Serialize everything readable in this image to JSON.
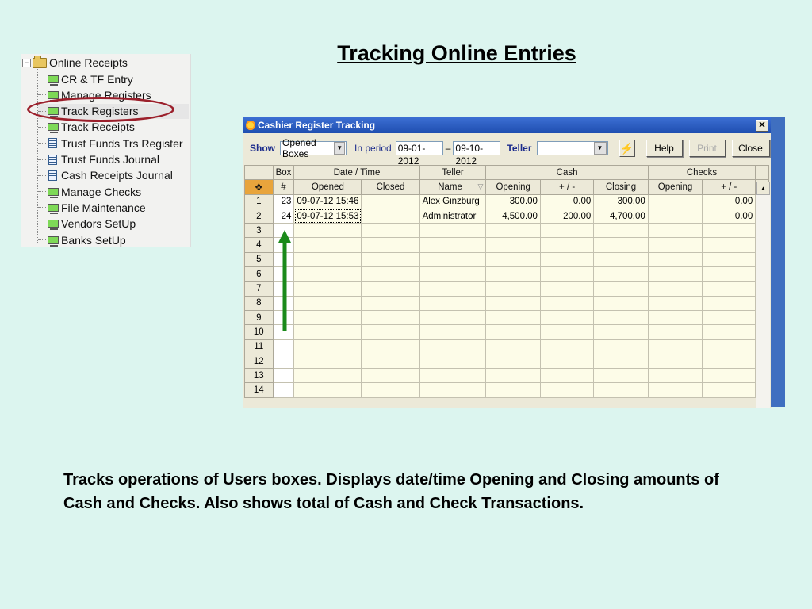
{
  "slide": {
    "title": "Tracking Online Entries",
    "description": "Tracks operations of Users boxes.  Displays date/time Opening and Closing amounts of Cash and Checks.  Also shows total of Cash and Check Transactions."
  },
  "tree": {
    "root": "Online Receipts",
    "items": [
      {
        "label": "CR & TF Entry",
        "icon": "computer-icon"
      },
      {
        "label": "Manage Registers",
        "icon": "computer-icon"
      },
      {
        "label": "Track Registers",
        "icon": "computer-icon"
      },
      {
        "label": "Track Receipts",
        "icon": "computer-icon"
      },
      {
        "label": "Trust Funds Trs Register",
        "icon": "document-icon"
      },
      {
        "label": "Trust Funds Journal",
        "icon": "document-icon"
      },
      {
        "label": "Cash Receipts Journal",
        "icon": "document-icon"
      },
      {
        "label": "Manage Checks",
        "icon": "computer-icon"
      },
      {
        "label": "File Maintenance",
        "icon": "computer-icon"
      },
      {
        "label": "Vendors SetUp",
        "icon": "computer-icon"
      },
      {
        "label": "Banks SetUp",
        "icon": "computer-icon"
      }
    ]
  },
  "window": {
    "title": "Cashier Register Tracking",
    "close": "✕",
    "toolbar": {
      "show_label": "Show",
      "show_value": "Opened Boxes",
      "period_label": "In period",
      "date_from": "09-01-2012",
      "date_sep": "–",
      "date_to": "09-10-2012",
      "teller_label": "Teller",
      "teller_value": "",
      "help": "Help",
      "print": "Print",
      "close": "Close"
    },
    "grid": {
      "groups": [
        "Box",
        "Date / Time",
        "Teller",
        "Cash",
        "Checks"
      ],
      "headers": [
        "#",
        "Opened",
        "Closed",
        "Name",
        "Opening",
        "+ / -",
        "Closing",
        "Opening",
        "+ / -"
      ],
      "rows": [
        {
          "n": "1",
          "box": "23",
          "opened": "09-07-12 15:46",
          "closed": "",
          "name": "Alex Ginzburg",
          "cash_open": "300.00",
          "cash_pm": "0.00",
          "cash_close": "300.00",
          "chk_open": "",
          "chk_pm": "0.00"
        },
        {
          "n": "2",
          "box": "24",
          "opened": "09-07-12 15:53",
          "closed": "",
          "name": "Administrator",
          "cash_open": "4,500.00",
          "cash_pm": "200.00",
          "cash_close": "4,700.00",
          "chk_open": "",
          "chk_pm": "0.00"
        }
      ],
      "empty_rows": [
        "3",
        "4",
        "5",
        "6",
        "7",
        "8",
        "9",
        "10",
        "11",
        "12",
        "13",
        "14"
      ]
    }
  },
  "colors": {
    "slide_bg": "#dcf5ef",
    "highlight_circle": "#9b1f2b",
    "arrow": "#1a8a1a",
    "title_bar": "#2c5cc5"
  }
}
